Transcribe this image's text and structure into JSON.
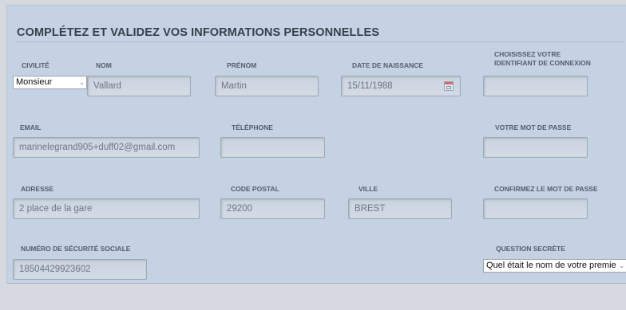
{
  "form": {
    "title": "COMPLÉTEZ ET VALIDEZ VOS INFORMATIONS PERSONNELLES",
    "labels": {
      "civilite": "CIVILITÉ",
      "nom": "NOM",
      "prenom": "PRÉNOM",
      "date_naissance": "DATE DE NAISSANCE",
      "identifiant_line1": "CHOISISSEZ VOTRE",
      "identifiant_line2": "IDENTIFIANT DE CONNEXION",
      "email": "EMAIL",
      "telephone": "TÉLÉPHONE",
      "mot_de_passe": "VOTRE MOT DE PASSE",
      "adresse": "ADRESSE",
      "code_postal": "CODE POSTAL",
      "ville": "VILLE",
      "confirmez_mot_de_passe": "CONFIRMEZ LE MOT DE PASSE",
      "numero_securite_sociale": "NUMÉRO DE SÉCURITÉ SOCIALE",
      "question_secrete": "QUESTION SECRÈTE"
    },
    "values": {
      "civilite": "Monsieur",
      "nom": "Vallard",
      "prenom": "Martin",
      "date_naissance": "15/11/1988",
      "identifiant": "",
      "email": "marinelegrand905+duff02@gmail.com",
      "telephone": "",
      "mot_de_passe": "",
      "adresse": "2 place de la gare",
      "code_postal": "29200",
      "ville": "BREST",
      "confirmez_mot_de_passe": "",
      "numero_securite_sociale": "18504429923602",
      "question_secrete": "Quel était le nom de votre premie"
    },
    "icons": {
      "select_arrow": "chevron-down-icon",
      "date_picker": "calendar-icon"
    },
    "colors": {
      "panel_background": "#c5d2e3",
      "page_background": "#d6d9df",
      "title_text": "#36404b"
    }
  }
}
